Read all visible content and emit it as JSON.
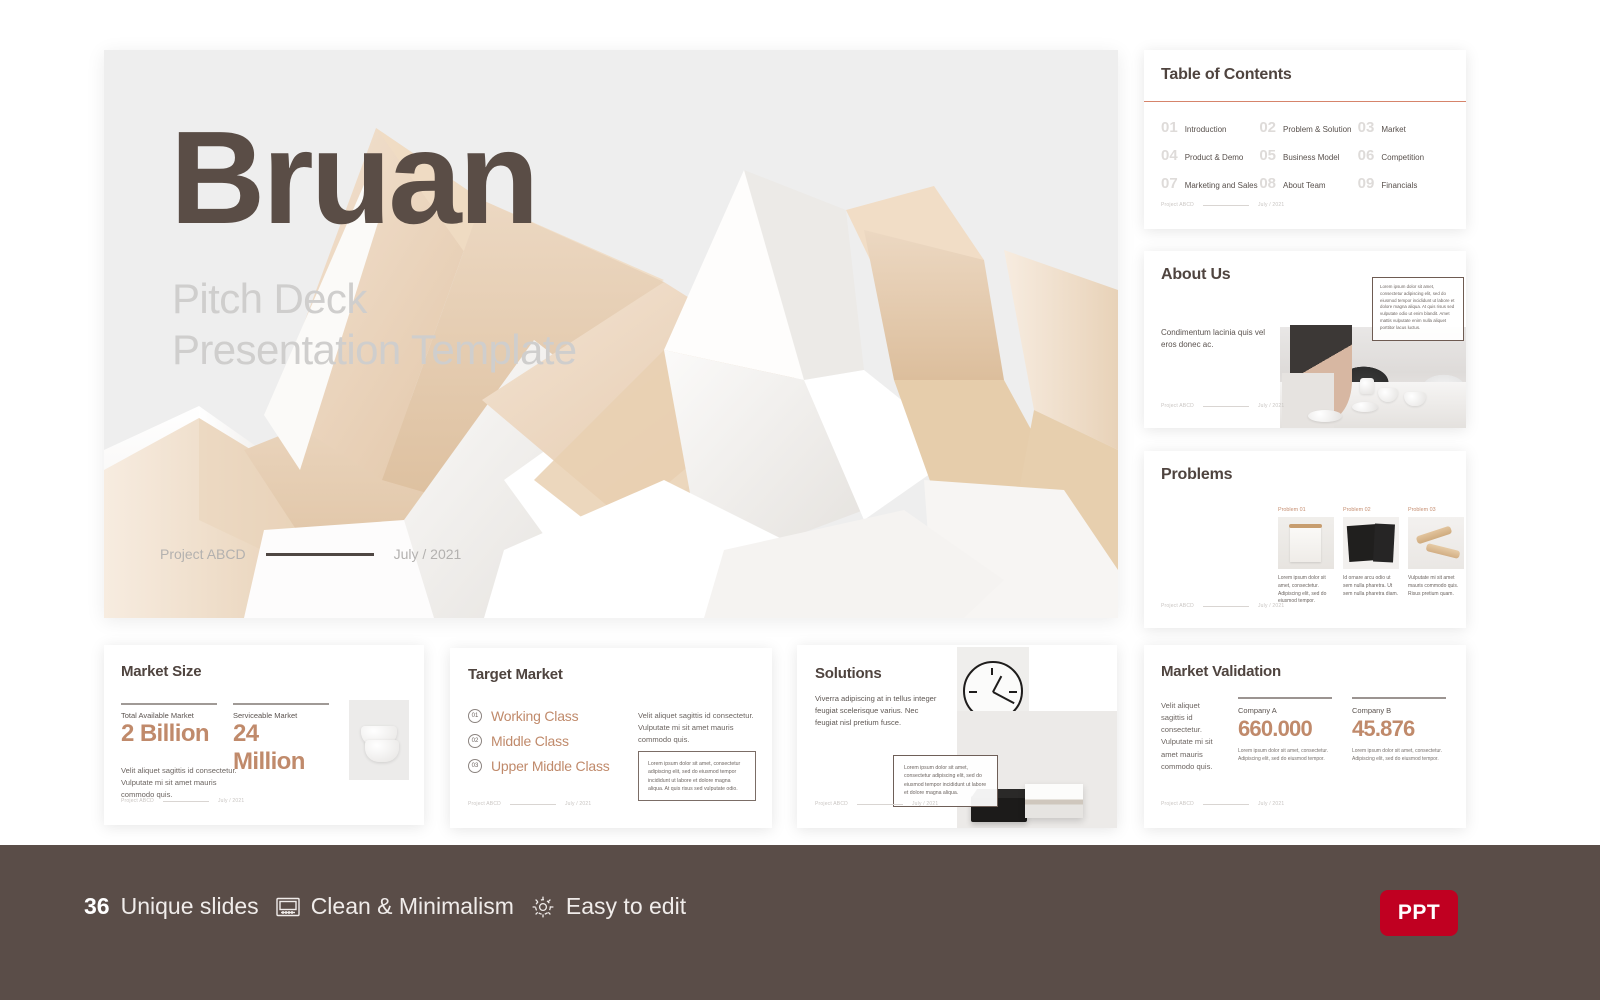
{
  "hero": {
    "title": "Bruan",
    "subtitle_line1": "Pitch Deck",
    "subtitle_line2": "Presentation Template",
    "project": "Project ABCD",
    "date": "July / 2021"
  },
  "footer_meta": {
    "project": "Project ABCD",
    "date": "July / 2021"
  },
  "toc": {
    "title": "Table of Contents",
    "items": [
      {
        "num": "01",
        "label": "Introduction"
      },
      {
        "num": "02",
        "label": "Problem & Solution"
      },
      {
        "num": "03",
        "label": "Market"
      },
      {
        "num": "04",
        "label": "Product & Demo"
      },
      {
        "num": "05",
        "label": "Business Model"
      },
      {
        "num": "06",
        "label": "Competition"
      },
      {
        "num": "07",
        "label": "Marketing and Sales"
      },
      {
        "num": "08",
        "label": "About Team"
      },
      {
        "num": "09",
        "label": "Financials"
      }
    ]
  },
  "about": {
    "title": "About Us",
    "body": "Condimentum lacinia quis vel eros donec ac.",
    "quote": "Lorem ipsum dolor sit amet, consectetur adipiscing elit, sed do eiusmod tempor incididunt ut labore et dolore magna aliqua. At quis risus sed vulputate odio ut enim blandit. Amet mattis vulputate enim nulla aliquet porttitor lacus luctus."
  },
  "problems": {
    "title": "Problems",
    "cards": [
      {
        "label": "Problem 01",
        "text": "Lorem ipsum dolor sit amet, consectetur. Adipiscing elit, sed do eiusmod tempor."
      },
      {
        "label": "Problem 02",
        "text": "Id ornare arcu odio ut sem nulla pharetra. Ut sem nulla pharetra diam."
      },
      {
        "label": "Problem 03",
        "text": "Vulputate mi sit amet mauris commodo quis. Risus pretium quam."
      }
    ]
  },
  "market_size": {
    "title": "Market Size",
    "stats": [
      {
        "label": "Total Available Market",
        "value": "2 Billion"
      },
      {
        "label": "Serviceable Market",
        "value": "24 Million"
      }
    ],
    "description": "Velit aliquet sagittis id consectetur. Vulputate mi sit amet mauris commodo quis."
  },
  "target_market": {
    "title": "Target Market",
    "items": [
      {
        "num": "01",
        "label": "Working Class"
      },
      {
        "num": "02",
        "label": "Middle Class"
      },
      {
        "num": "03",
        "label": "Upper Middle Class"
      }
    ],
    "description": "Velit aliquet sagittis id consectetur. Vulputate mi sit amet mauris commodo quis.",
    "box_text": "Lorem ipsum dolor sit amet, consectetur adipiscing elit, sed do eiusmod tempor incididunt ut labore et dolore magna aliqua. At quis risus sed vulputate odio."
  },
  "solutions": {
    "title": "Solutions",
    "description": "Viverra adipiscing at in tellus integer feugiat scelerisque varius. Nec feugiat nisl pretium fusce.",
    "box_text": "Lorem ipsum dolor sit amet, consectetur adipiscing elit, sed do eiusmod tempor incididunt ut labore et dolore magna aliqua."
  },
  "market_validation": {
    "title": "Market Validation",
    "description": "Velit aliquet sagittis id consectetur. Vulputate mi sit amet mauris commodo quis.",
    "companies": [
      {
        "label": "Company A",
        "value": "660.000",
        "note": "Lorem ipsum dolor sit amet, consectetur. Adipiscing elit, sed do eiusmod tempor."
      },
      {
        "label": "Company B",
        "value": "45.876",
        "note": "Lorem ipsum dolor sit amet, consectetur. Adipiscing elit, sed do eiusmod tempor."
      }
    ]
  },
  "promo_bar": {
    "slide_count": "36",
    "slide_count_label": "Unique slides",
    "feature_clean": "Clean & Minimalism",
    "feature_edit": "Easy to edit",
    "badge": "PPT",
    "icons": {
      "monitor": "monitor-icon",
      "gear": "gear-icon"
    }
  },
  "colors": {
    "accent": "#c08a6b",
    "dark": "#5a4d48",
    "toc_rule": "#d6846b",
    "badge_red": "#c00021",
    "hero_bg": "#eeeeee"
  }
}
